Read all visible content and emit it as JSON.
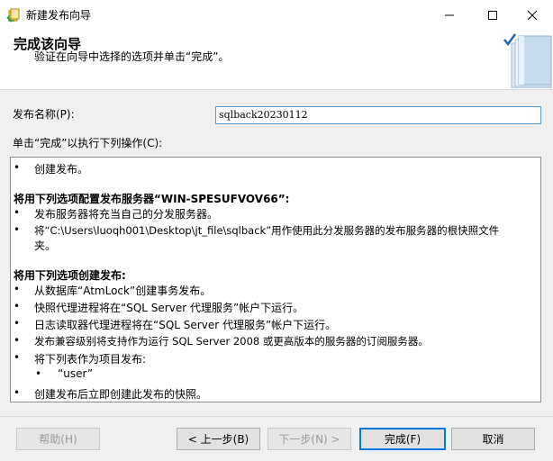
{
  "window": {
    "title": "新建发布向导",
    "controls": {
      "minimize": "—",
      "maximize": "☐",
      "close": "✕"
    }
  },
  "header": {
    "title": "完成该向导",
    "subtitle": "验证在向导中选择的选项并单击“完成”。"
  },
  "form": {
    "name_label": "发布名称(P):",
    "name_value": "sqlback20230112",
    "actions_label": "单击“完成”以执行下列操作(C):"
  },
  "actions": {
    "bullet": "•",
    "item_create": "创建发布。",
    "section1_title": "将用下列选项配置发布服务器“WIN-SPESUFVOV66”:",
    "s1_item1": "发布服务器将充当自己的分发服务器。",
    "s1_item2_line1": "将“C:\\Users\\luoqh001\\Desktop\\jt_file\\sqlback”用作使用此分发服务器的发布服务器的根快照文件",
    "s1_item2_line2": "夹。",
    "section2_title": "将用下列选项创建发布:",
    "s2_item1": "从数据库“AtmLock”创建事务发布。",
    "s2_item2": "快照代理进程将在“SQL Server 代理服务”帐户下运行。",
    "s2_item3": "日志读取器代理进程将在“SQL Server 代理服务”帐户下运行。",
    "s2_item4": "发布兼容级别将支持作为运行 SQL Server 2008 或更高版本的服务器的订阅服务器。",
    "s2_item5": "将下列表作为项目发布:",
    "s2_sub_item": "“user”",
    "s2_item6": "创建发布后立即创建此发布的快照。"
  },
  "buttons": {
    "help": "帮助(H)",
    "back": "< 上一步(B)",
    "next": "下一步(N) >",
    "finish": "完成(F)",
    "cancel": "取消"
  },
  "colors": {
    "accent": "#0078d7",
    "input_border": "#5a9bd5"
  }
}
